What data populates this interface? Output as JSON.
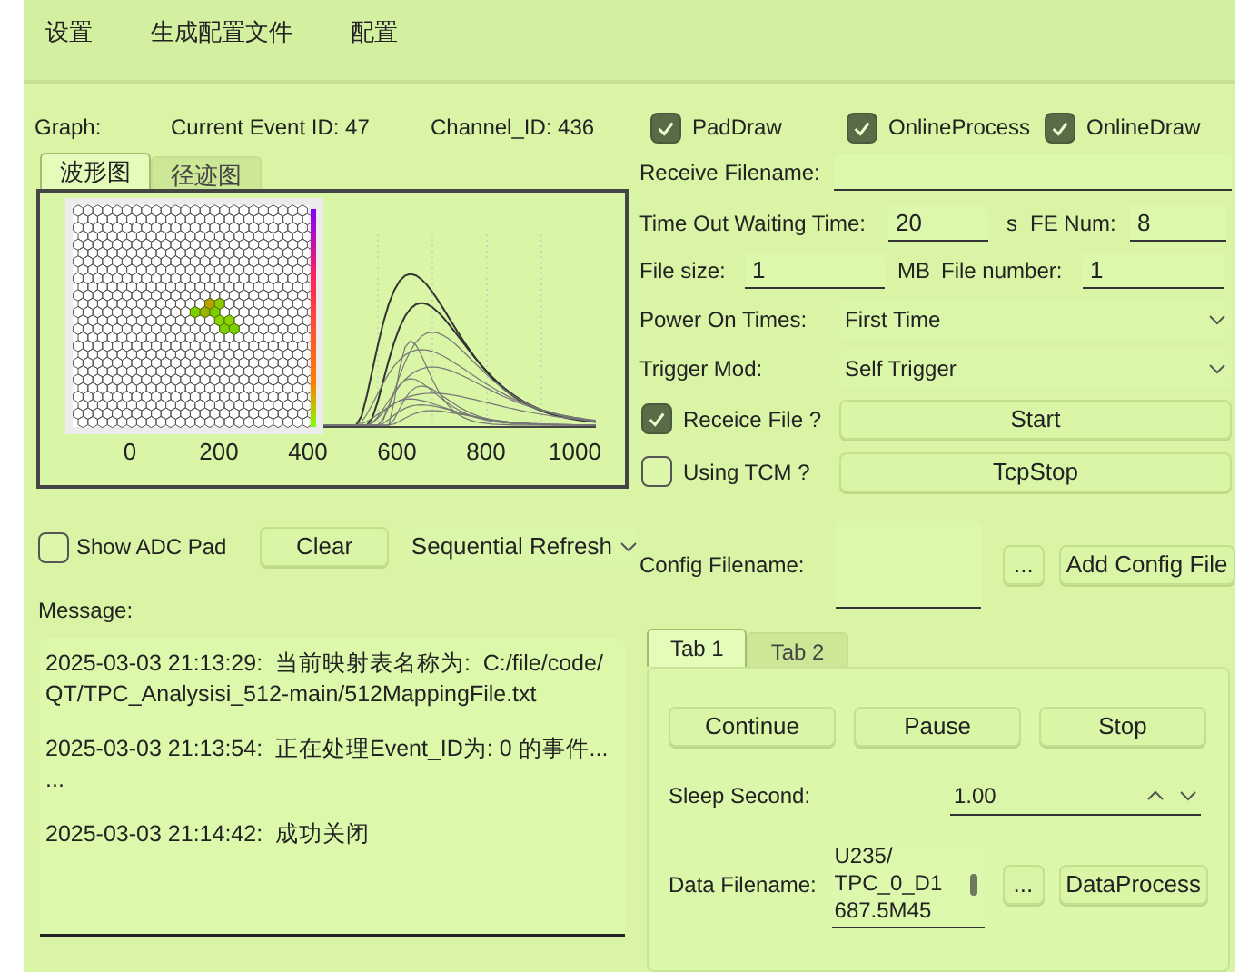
{
  "menu": [
    "设置",
    "生成配置文件",
    "配置"
  ],
  "info": {
    "graph_label": "Graph:",
    "event": "Current Event ID: 47",
    "channel": "Channel_ID: 436"
  },
  "toggles": [
    {
      "label": "PadDraw",
      "checked": true
    },
    {
      "label": "OnlineProcess",
      "checked": true
    },
    {
      "label": "OnlineDraw",
      "checked": true
    }
  ],
  "graph_tabs": [
    {
      "label": "波形图",
      "selected": true
    },
    {
      "label": "径迹图",
      "selected": false
    }
  ],
  "graph": {
    "x_tick_labels": [
      "0",
      "200",
      "400",
      "600",
      "800",
      "1000"
    ]
  },
  "receive_filename": {
    "label": "Receive Filename:"
  },
  "timeout": {
    "label": "Time Out Waiting Time:",
    "value": "20",
    "unit": "s"
  },
  "fe_num": {
    "label": "FE Num:",
    "value": "8"
  },
  "file_size": {
    "label": "File  size:",
    "value": "1",
    "unit": "MB"
  },
  "file_number": {
    "label": "File number:",
    "value": "1"
  },
  "power_on": {
    "label": "Power On Times:",
    "value": "First Time"
  },
  "trigger": {
    "label": "Trigger Mod:",
    "value": "Self Trigger"
  },
  "receive_file": {
    "label": "Receice File ?",
    "checked": true,
    "button": "Start"
  },
  "using_tcm": {
    "label": "Using TCM ?",
    "checked": false,
    "button": "TcpStop"
  },
  "show_adc": {
    "label": "Show ADC Pad",
    "checked": false
  },
  "clear_button": "Clear",
  "refresh_mode": "Sequential Refresh",
  "config": {
    "label": "Config Filename:",
    "browse": "...",
    "button": "Add Config File"
  },
  "message": {
    "label": "Message:",
    "lines": [
      "2025-03-03 21:13:29:  当前映射表名称为:  C:/file/code/QT/TPC_Analysisi_512-main/512MappingFile.txt",
      "2025-03-03 21:13:54:  正在处理Event_ID为: 0 的事件...\n...",
      "2025-03-03 21:14:42:  成功关闭"
    ]
  },
  "run_tabs": [
    {
      "label": "Tab 1",
      "selected": true
    },
    {
      "label": "Tab 2",
      "selected": false
    }
  ],
  "run_buttons": [
    "Continue",
    "Pause",
    "Stop"
  ],
  "sleep": {
    "label": "Sleep Second:",
    "value": "1.00"
  },
  "data_file": {
    "label": "Data Filename:",
    "lines": [
      "U235/",
      "TPC_0_D1",
      "687.5M45"
    ],
    "browse": "...",
    "button": "DataProcess"
  }
}
